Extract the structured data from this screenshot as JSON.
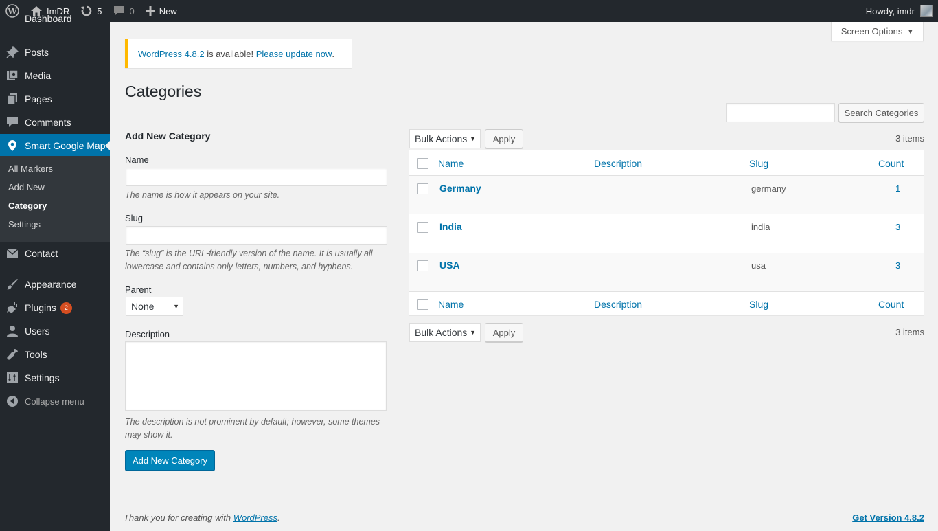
{
  "adminbar": {
    "site_name": "ImDR",
    "updates_count": "5",
    "comments_count": "0",
    "new_label": "New",
    "howdy": "Howdy, imdr"
  },
  "sidebar": {
    "dashboard_partial": "Dashboard",
    "items": [
      {
        "label": "Posts",
        "icon": "pushpin-icon"
      },
      {
        "label": "Media",
        "icon": "media-icon"
      },
      {
        "label": "Pages",
        "icon": "pages-icon"
      },
      {
        "label": "Comments",
        "icon": "comment-icon"
      },
      {
        "label": "Smart Google Map",
        "icon": "map-pin-icon"
      },
      {
        "label": "Contact",
        "icon": "mail-icon"
      },
      {
        "label": "Appearance",
        "icon": "brush-icon"
      },
      {
        "label": "Plugins",
        "icon": "plug-icon",
        "badge": "2"
      },
      {
        "label": "Users",
        "icon": "user-icon"
      },
      {
        "label": "Tools",
        "icon": "wrench-icon"
      },
      {
        "label": "Settings",
        "icon": "settings-icon"
      }
    ],
    "submenu": [
      "All Markers",
      "Add New",
      "Category",
      "Settings"
    ],
    "collapse": "Collapse menu"
  },
  "screen_options": "Screen Options",
  "notice": {
    "version_link": "WordPress 4.8.2",
    "text": " is available! ",
    "update_link": "Please update now",
    "end": "."
  },
  "page_title": "Categories",
  "search": {
    "button": "Search Categories",
    "value": ""
  },
  "form": {
    "heading": "Add New Category",
    "name_label": "Name",
    "name_help": "The name is how it appears on your site.",
    "slug_label": "Slug",
    "slug_help": "The “slug” is the URL-friendly version of the name. It is usually all lowercase and contains only letters, numbers, and hyphens.",
    "parent_label": "Parent",
    "parent_value": "None",
    "description_label": "Description",
    "description_help": "The description is not prominent by default; however, some themes may show it.",
    "submit": "Add New Category"
  },
  "table": {
    "bulk_actions": "Bulk Actions",
    "apply": "Apply",
    "items_count": "3 items",
    "columns": [
      "Name",
      "Description",
      "Slug",
      "Count"
    ],
    "rows": [
      {
        "name": "Germany",
        "description": "",
        "slug": "germany",
        "count": "1"
      },
      {
        "name": "India",
        "description": "",
        "slug": "india",
        "count": "3"
      },
      {
        "name": "USA",
        "description": "",
        "slug": "usa",
        "count": "3"
      }
    ]
  },
  "footer": {
    "thanks": "Thank you for creating with ",
    "wp_link": "WordPress",
    "thanks_end": ".",
    "version": "Get Version 4.8.2"
  },
  "colors": {
    "adminbar_bg": "#23282d",
    "accent": "#0073aa",
    "notice_border": "#ffb900",
    "badge": "#d54e21"
  }
}
